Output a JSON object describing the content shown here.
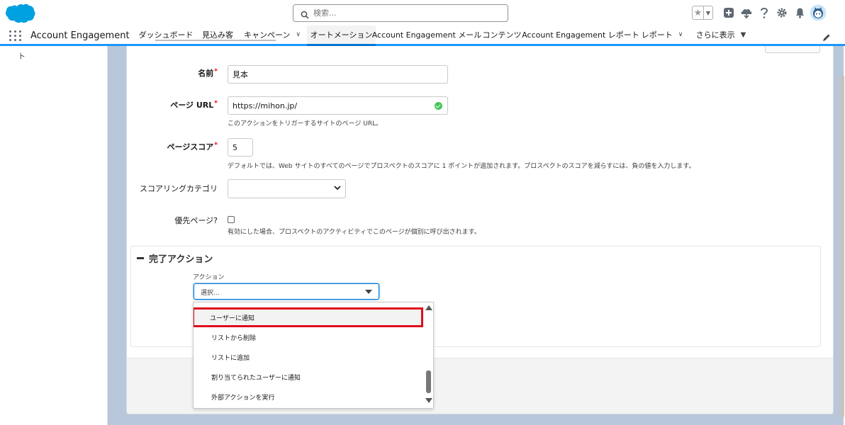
{
  "header": {
    "search_placeholder": "検索..."
  },
  "nav": {
    "app_name": "Account Engagement",
    "tabs": [
      {
        "label": "ダッシュボード"
      },
      {
        "label": "見込み客"
      },
      {
        "label": "キャンペーン"
      },
      {
        "label": "オートメーション"
      },
      {
        "label": "Account Engagement メール"
      },
      {
        "label": "コンテンツ"
      },
      {
        "label": "Account Engagement レポート"
      },
      {
        "label": "レポート"
      },
      {
        "label": "さらに表示"
      }
    ],
    "active_tab": "オートメーション"
  },
  "left_panel": {
    "stub_text": "ト"
  },
  "form": {
    "name_label": "名前",
    "name_value": "見本",
    "url_label": "ページ URL",
    "url_value": "https://mihon.jp/",
    "url_help": "このアクションをトリガーするサイトのページ URL。",
    "score_label": "ページスコア",
    "score_value": "5",
    "score_help": "デフォルトでは、Web サイトのすべてのページでプロスペクトのスコアに 1 ポイントが追加されます。プロスペクトのスコアを減らすには、負の値を入力します。",
    "category_label": "スコアリングカテゴリ",
    "priority_label": "優先ページ?",
    "priority_help": "有効にした場合、プロスペクトのアクティビティでこのページが個別に呼び出されます。",
    "required_mark": "*"
  },
  "completion": {
    "title": "完了アクション",
    "action_label": "アクション",
    "action_placeholder": "選択...",
    "options": [
      {
        "label": "ユーザーに通知",
        "highlighted": true
      },
      {
        "label": "リストから削除",
        "highlighted": false
      },
      {
        "label": "リストに追加",
        "highlighted": false
      },
      {
        "label": "割り当てられたユーザーに通知",
        "highlighted": false
      },
      {
        "label": "外部アクションを実行",
        "highlighted": false
      }
    ]
  },
  "colors": {
    "brand": "#00a1e0",
    "active_tab_border": "#0176d3",
    "highlight_outline": "#e00d1b",
    "success": "#45c65a",
    "page_bg": "#b8c7d9"
  }
}
